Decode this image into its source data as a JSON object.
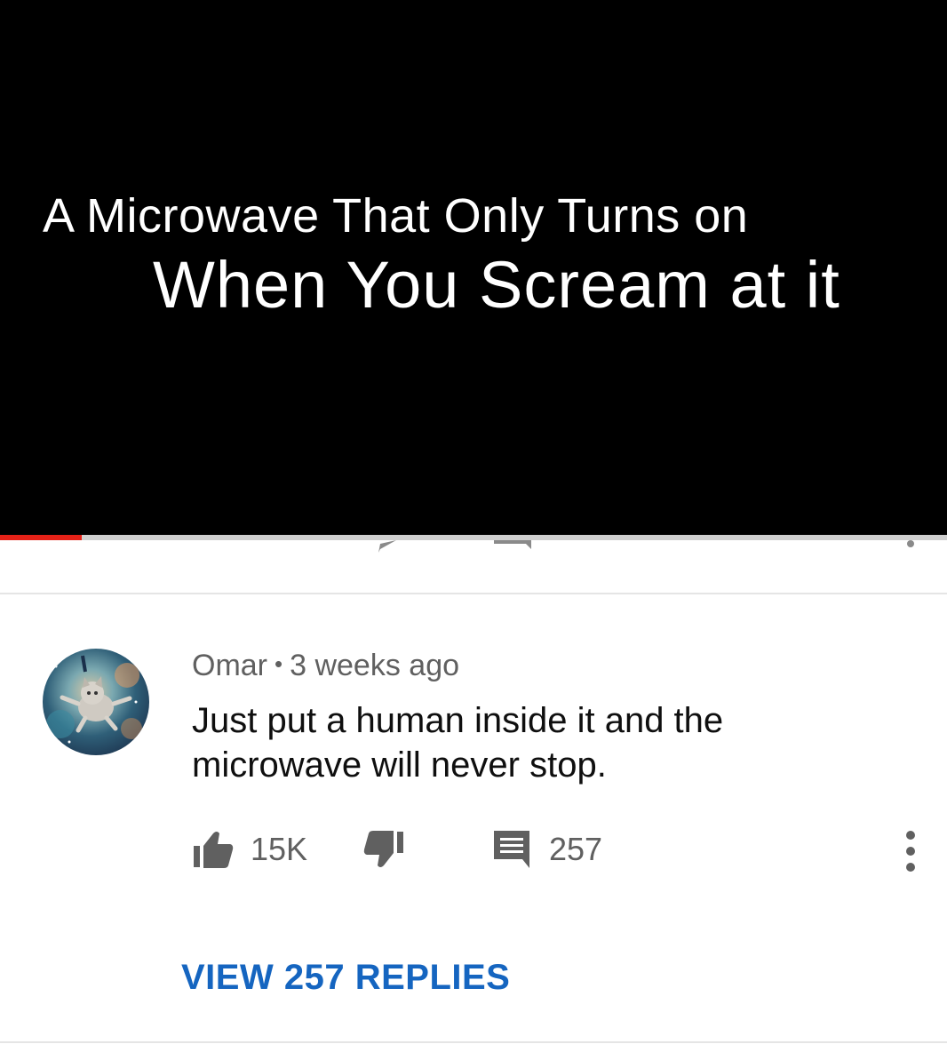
{
  "video": {
    "title_line_1": "A Microwave That Only Turns on",
    "title_line_2": "When You Scream at it",
    "progress_fraction": 0.086,
    "background_color": "#000000",
    "progress_color": "#e62117"
  },
  "comment": {
    "author": "Omar",
    "separator": "•",
    "timestamp": "3 weeks ago",
    "text": "Just put a human inside it and the microwave will never stop.",
    "avatar_icon": "cat-in-space-avatar",
    "actions": {
      "like_icon": "thumbs-up-icon",
      "like_count": "15K",
      "dislike_icon": "thumbs-down-icon",
      "reply_icon": "comment-icon",
      "reply_count": "257",
      "more_icon": "more-vertical-icon"
    },
    "view_replies_label": "VIEW 257 REPLIES"
  },
  "colors": {
    "secondary_text": "#606060",
    "primary_text": "#0f0f0f",
    "link_blue": "#1565c0",
    "divider": "#e5e5e5"
  }
}
